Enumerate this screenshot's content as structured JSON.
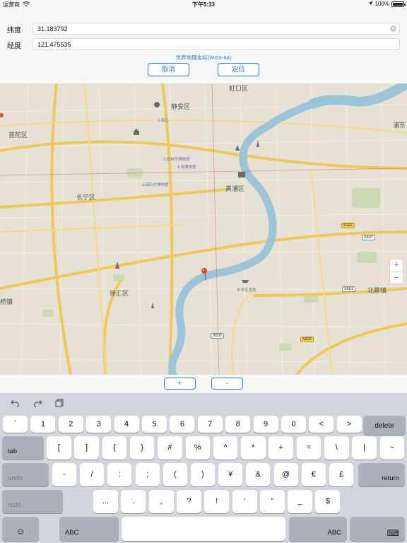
{
  "status_bar": {
    "carrier": "运营商",
    "time": "下午5:33",
    "battery_text": "100%",
    "battery_level": 1.0
  },
  "form": {
    "latitude_label": "纬度",
    "latitude_value": "31.183792",
    "longitude_label": "经度",
    "longitude_value": "121.475535",
    "coord_system_note": "世界地理坐标(WGS-84)",
    "cancel_label": "取消",
    "locate_label": "定位"
  },
  "map": {
    "labels": {
      "hongkou": "虹口区",
      "jingan": "静安区",
      "putuo": "普陀区",
      "changning": "长宁区",
      "huangpu": "黄浦区",
      "xuhui": "徐汇区",
      "pudong": "浦东",
      "beicai": "北蔡镇",
      "qiao": "桥镇",
      "shanghai_station": "上海站",
      "museum": "上海自然博物馆",
      "shanghai_zoo": "上海博物馆",
      "expo": "中华艺术宫",
      "people_square": "上海历史博物馆",
      "s122": "S122",
      "x637": "X637",
      "x601": "X601",
      "x603": "X603",
      "s202": "S202"
    },
    "zoom_in": "+",
    "zoom_out": "−"
  },
  "zoom_buttons": {
    "plus": "+",
    "minus": "-"
  },
  "keyboard": {
    "row1": [
      "`",
      "1",
      "2",
      "3",
      "4",
      "5",
      "6",
      "7",
      "8",
      "9",
      "0",
      "<",
      ">"
    ],
    "delete": "delete",
    "tab": "tab",
    "row2": [
      "[",
      "]",
      "{",
      "}",
      "#",
      "%",
      "^",
      "*",
      "+",
      "=",
      "\\",
      "|",
      "~"
    ],
    "undo": "undo",
    "row3": [
      "-",
      "/",
      ":",
      ";",
      "(",
      ")",
      "¥",
      "&",
      "@",
      "€",
      "£"
    ],
    "return": "return",
    "redo": "redo",
    "row4": [
      "...",
      ".",
      ",",
      "?",
      "!",
      "’",
      "”",
      "_",
      "$"
    ],
    "emoji": "☺",
    "abc_left": "ABC",
    "abc_right": "ABC",
    "hide_keyboard": "⌨"
  }
}
